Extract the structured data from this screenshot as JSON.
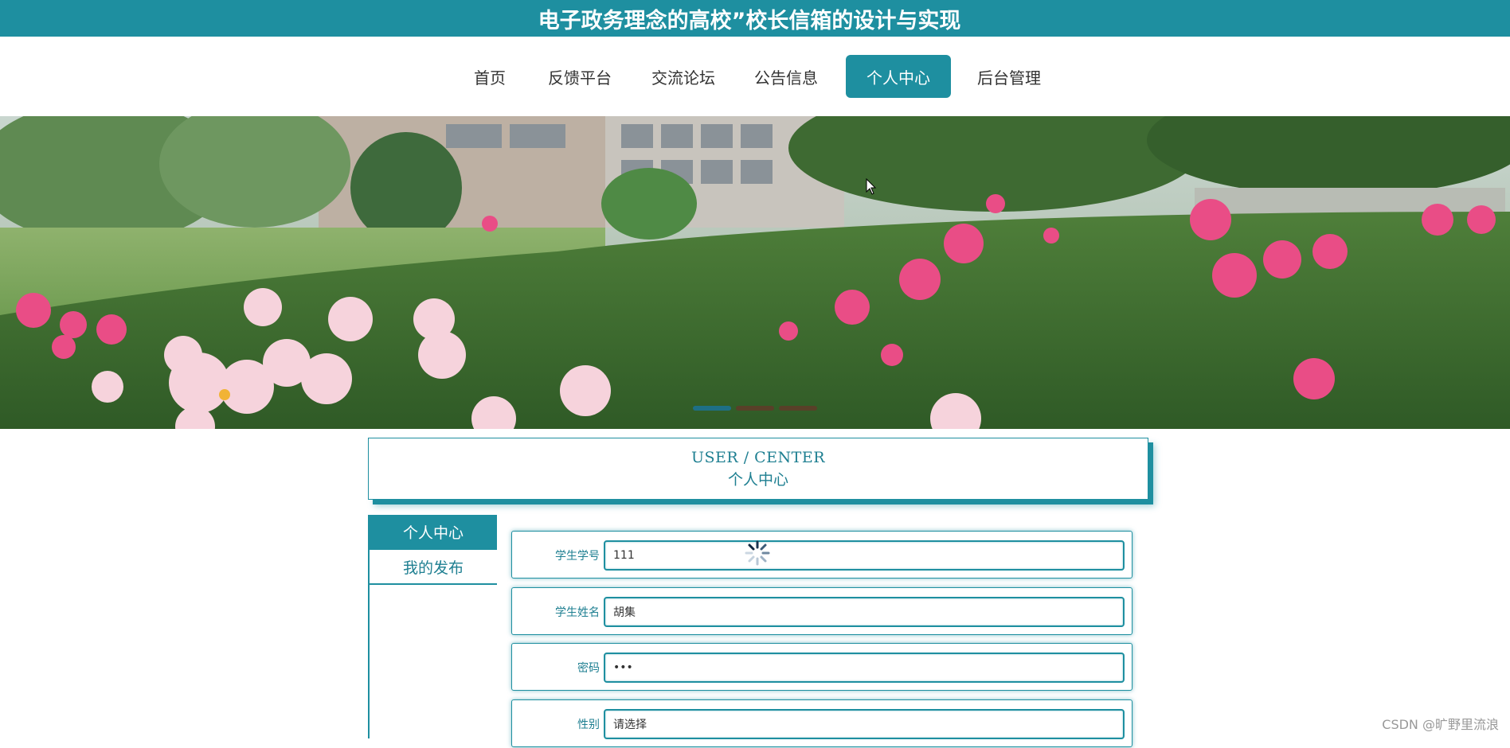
{
  "header": {
    "title": "电子政务理念的高校”校长信箱的设计与实现"
  },
  "nav": {
    "items": [
      {
        "label": "首页",
        "active": false
      },
      {
        "label": "反馈平台",
        "active": false
      },
      {
        "label": "交流论坛",
        "active": false
      },
      {
        "label": "公告信息",
        "active": false
      },
      {
        "label": "个人中心",
        "active": true
      },
      {
        "label": "后台管理",
        "active": false
      }
    ]
  },
  "banner": {
    "slide_count": 3,
    "active_slide": 1
  },
  "section": {
    "title_en": "USER / CENTER",
    "title_cn": "个人中心"
  },
  "sidebar": {
    "items": [
      {
        "label": "个人中心",
        "active": true
      },
      {
        "label": "我的发布",
        "active": false
      }
    ]
  },
  "form": {
    "fields": [
      {
        "label": "学生学号",
        "value": "111"
      },
      {
        "label": "学生姓名",
        "value": "胡集"
      },
      {
        "label": "密码",
        "value": "•••"
      },
      {
        "label": "性别",
        "value": "请选择"
      }
    ]
  },
  "watermark": "CSDN @旷野里流浪",
  "colors": {
    "accent": "#1e8fa0"
  }
}
